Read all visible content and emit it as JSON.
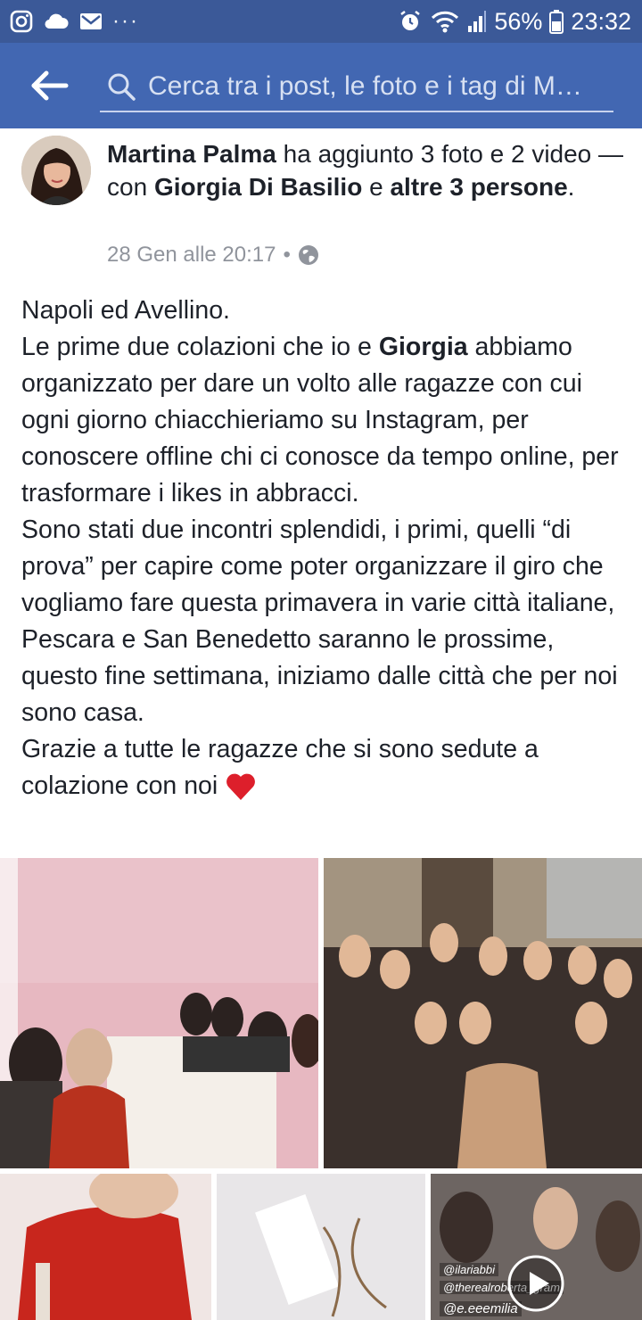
{
  "status_bar": {
    "battery": "56%",
    "time": "23:32",
    "left_icons": [
      "instagram-icon",
      "cloud-icon",
      "mail-icon",
      "more-icon"
    ],
    "right_icons": [
      "alarm-icon",
      "wifi-icon",
      "signal-icon",
      "battery-icon"
    ]
  },
  "appbar": {
    "search_placeholder": "Cerca tra i post, le foto e i tag di M…",
    "color": "#4267b2"
  },
  "post": {
    "author": "Martina Palma",
    "action_1": " ha aggiunto 3 foto e 2 video — con ",
    "tagged_1": "Giorgia Di Basilio",
    "action_2": " e ",
    "tagged_2": "altre 3 persone",
    "action_3": ".",
    "date": "28 Gen alle 20:17",
    "separator": "•",
    "privacy_icon": "globe-icon",
    "text_p1": "Napoli ed Avellino.",
    "text_p2_a": "Le prime due colazioni che io e ",
    "text_p2_bold": "Giorgia",
    "text_p2_b": " abbiamo organizzato per dare un volto alle ragazze con cui ogni giorno chiacchieriamo su Instagram, per conoscere offline chi ci conosce da tempo online, per trasformare i likes in abbracci.",
    "text_p3": "Sono stati due incontri splendidi, i primi, quelli “di prova” per capire come poter organizzare il giro che vogliamo fare questa primavera in varie città italiane, Pescara e San Benedetto saranno le prossime, questo fine settimana, iniziamo dalle città che per noi sono casa.",
    "text_p4": "Grazie a tutte le ragazze che si sono sedute a colazione con noi",
    "emoji": "heart-icon"
  },
  "media": {
    "photo5_tags": [
      "@ilariabbi",
      "@therealroberta_gram",
      "@e.eeemilia"
    ],
    "play_icon": "play-icon"
  }
}
